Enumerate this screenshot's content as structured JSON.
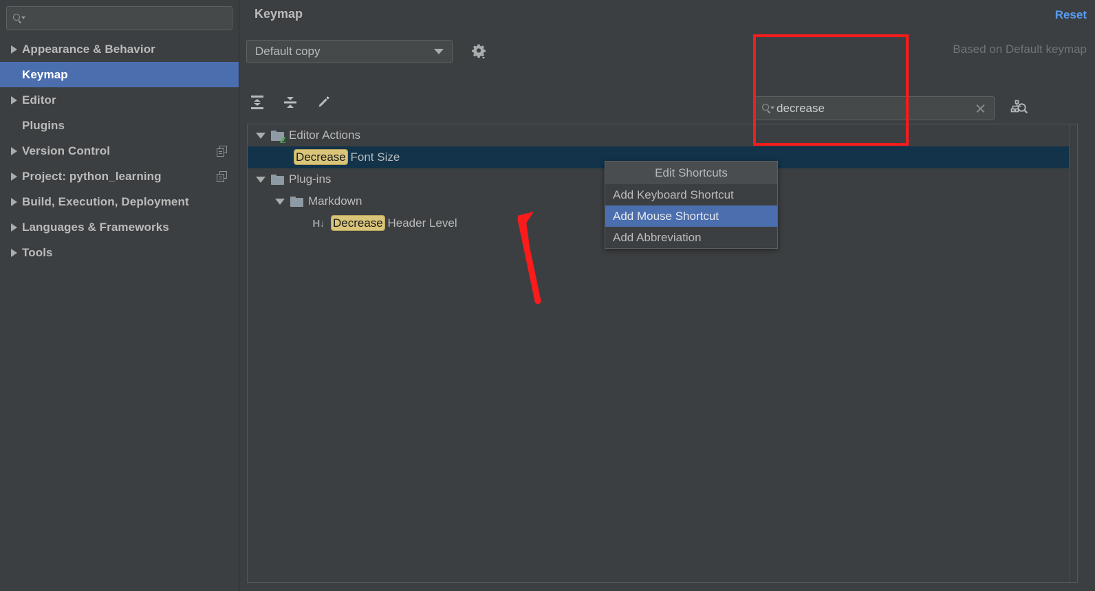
{
  "sidebar": {
    "search": {
      "placeholder": "",
      "value": "",
      "icon": "search-icon"
    },
    "items": [
      {
        "label": "Appearance & Behavior",
        "expandable": true,
        "selected": false,
        "copy_icon": false
      },
      {
        "label": "Keymap",
        "expandable": false,
        "selected": true,
        "copy_icon": false
      },
      {
        "label": "Editor",
        "expandable": true,
        "selected": false,
        "copy_icon": false
      },
      {
        "label": "Plugins",
        "expandable": false,
        "selected": false,
        "copy_icon": false
      },
      {
        "label": "Version Control",
        "expandable": true,
        "selected": false,
        "copy_icon": true
      },
      {
        "label": "Project: python_learning",
        "expandable": true,
        "selected": false,
        "copy_icon": true
      },
      {
        "label": "Build, Execution, Deployment",
        "expandable": true,
        "selected": false,
        "copy_icon": false
      },
      {
        "label": "Languages & Frameworks",
        "expandable": true,
        "selected": false,
        "copy_icon": false
      },
      {
        "label": "Tools",
        "expandable": true,
        "selected": false,
        "copy_icon": false
      }
    ]
  },
  "header": {
    "title": "Keymap",
    "reset_label": "Reset",
    "based_on": "Based on Default keymap",
    "keymap_selected": "Default copy",
    "gear_icon": "gear-icon"
  },
  "toolbar": {
    "buttons": [
      {
        "name": "expand-all-icon",
        "tooltip": "Expand All"
      },
      {
        "name": "collapse-all-icon",
        "tooltip": "Collapse All"
      },
      {
        "name": "edit-shortcut-icon",
        "tooltip": "Edit Shortcut"
      }
    ]
  },
  "action_search": {
    "value": "decrease",
    "placeholder": "",
    "clear_label": "×",
    "shortcut_search_icon": "shortcut-search-icon"
  },
  "tree": {
    "rows": [
      {
        "id": "editor-actions",
        "type": "folder",
        "depth": 0,
        "expanded": true,
        "label": "Editor Actions",
        "highlight": "",
        "rest": "Editor Actions",
        "selected": false,
        "icon": "folder-edit-icon"
      },
      {
        "id": "decrease-font-size",
        "type": "action",
        "depth": 1,
        "expanded": null,
        "label": "Decrease Font Size",
        "highlight": "Decrease",
        "rest": " Font Size",
        "selected": true,
        "icon": ""
      },
      {
        "id": "plug-ins",
        "type": "folder",
        "depth": 0,
        "expanded": true,
        "label": "Plug-ins",
        "highlight": "",
        "rest": "Plug-ins",
        "selected": false,
        "icon": "folder-icon"
      },
      {
        "id": "markdown",
        "type": "folder",
        "depth": 1,
        "expanded": true,
        "label": "Markdown",
        "highlight": "",
        "rest": "Markdown",
        "selected": false,
        "icon": "folder-icon"
      },
      {
        "id": "decrease-header-level",
        "type": "action",
        "depth": 2,
        "expanded": null,
        "label": "Decrease Header Level",
        "highlight": "Decrease",
        "rest": " Header Level",
        "selected": false,
        "icon": "header-decrease-icon"
      }
    ]
  },
  "context_menu": {
    "header": "Edit Shortcuts",
    "items": [
      {
        "label": "Add Keyboard Shortcut",
        "highlighted": false
      },
      {
        "label": "Add Mouse Shortcut",
        "highlighted": true
      },
      {
        "label": "Add Abbreviation",
        "highlighted": false
      }
    ]
  },
  "annotations": {
    "box": {
      "name": "search-highlight-box",
      "color": "#fc1b1b"
    },
    "arrow": {
      "name": "pointer-arrow",
      "color": "#fc1b1b",
      "points_to": "Add Mouse Shortcut"
    }
  },
  "colors": {
    "background": "#3c3f41",
    "selection_blue": "#4b6eaf",
    "tree_selection": "#12334a",
    "highlight_yellow": "#d9c479",
    "link_blue": "#589df6",
    "annotation_red": "#fc1b1b"
  }
}
